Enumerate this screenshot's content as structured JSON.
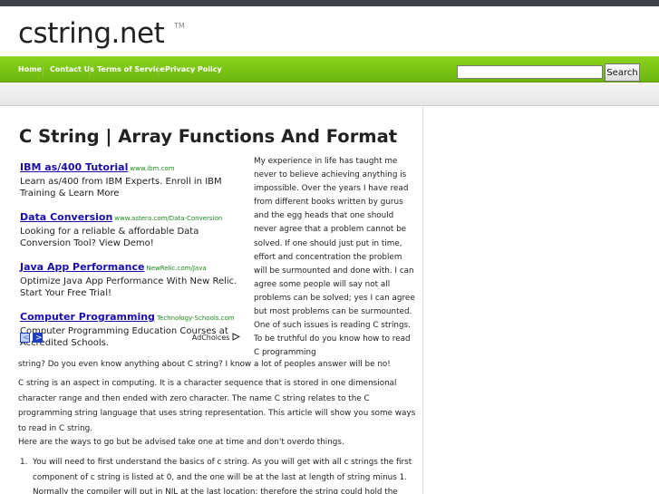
{
  "site": {
    "name": "cstring.net",
    "tm": "TM"
  },
  "nav": {
    "items": [
      "Home",
      "Contact Us",
      "Terms of Service",
      "Privacy Policy"
    ],
    "search_button": "Search"
  },
  "article": {
    "title": "C String | Array Functions And Format",
    "intro_side": "My experience in life has taught me never to believe achieving anything is impossible. Over the years I have read from different books written by gurus and the egg heads that one should never agree that a problem cannot be solved. If one should just put in time, effort and concentration the problem will be surmounted and done with. I can agree some people will say not all problems can be solved; yes I can agree but most problems can be surmounted. One of such issues is reading C strings. To be truthful do you know how to read C programming",
    "intro_continue": "string? Do you even know anything about C string? I know a lot of peoples answer will be no!",
    "para1": "C string is an aspect in computing. It is a character sequence that is stored in one dimensional character range and then ended with zero character. The name C string relates to the C programming string language that uses string representation.  This article will show you some ways to read in C string.",
    "para2": "Here are the ways to go but be advised take one at time and don't overdo things.",
    "list_item_1_number": "1.",
    "list_item_1": "You will need to first understand the basics of c string. As you will get with all c strings the first component of c string is listed at 0, and the one will be at the last at length of string minus 1. Normally the compiler will put in NIL at the last location; therefore the string could hold the"
  },
  "ads": {
    "items": [
      {
        "title": "IBM as/400 Tutorial",
        "url": "www.ibm.com",
        "desc": "Learn as/400 from IBM Experts. Enroll in IBM Training & Learn More"
      },
      {
        "title": "Data Conversion",
        "url": "www.astera.com/Data-Conversion",
        "desc": "Looking for a reliable & affordable Data Conversion Tool? View Demo!"
      },
      {
        "title": "Java App Performance",
        "url": "NewRelic.com/Java",
        "desc": "Optimize Java App Performance With New Relic. Start Your Free Trial!"
      },
      {
        "title": "Computer Programming",
        "url": "Technology-Schools.com",
        "desc": "Computer Programming Education Courses at Accredited Schools."
      }
    ],
    "adchoices": "AdChoices",
    "prev_glyph": "<",
    "next_glyph": ">"
  },
  "colors": {
    "nav_green": "#7ac41a",
    "ad_link": "#1a0dab",
    "ad_url": "#1a8a1a"
  }
}
